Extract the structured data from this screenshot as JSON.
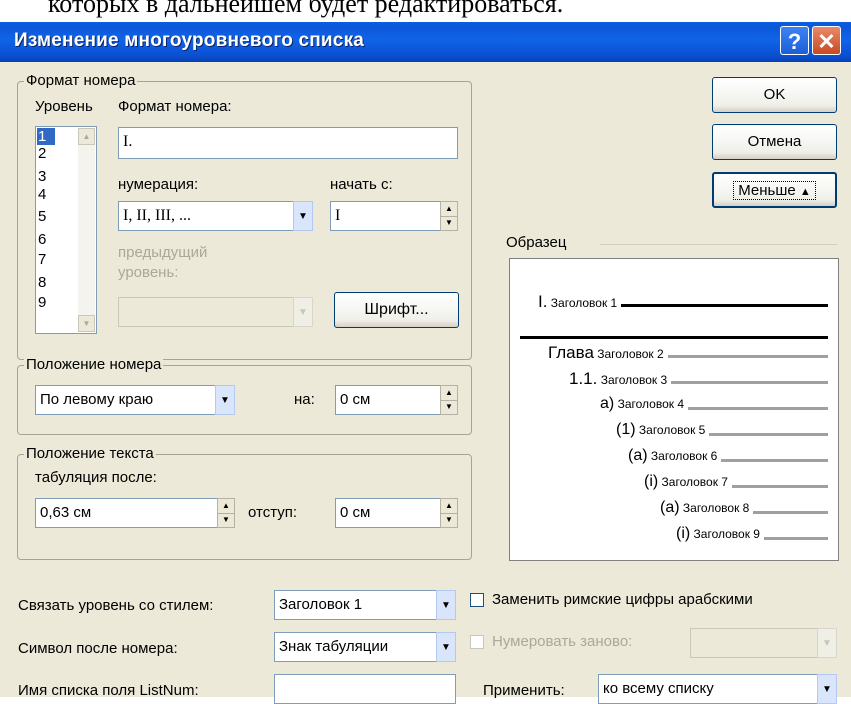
{
  "background_text": "которых в дальнейшем будет редактироваться.",
  "window": {
    "title": "Изменение многоуровневого списка",
    "help": "?",
    "close": "✕"
  },
  "number_format_group": {
    "legend": "Формат номера",
    "level_label": "Уровень",
    "format_label": "Формат номера:",
    "format_value": "I.",
    "levels": [
      "1",
      "2",
      "3",
      "4",
      "5",
      "6",
      "7",
      "8",
      "9"
    ],
    "selected_level": "1",
    "numbering_label": "нумерация:",
    "numbering_value": "I, II, III, ...",
    "start_label": "начать с:",
    "start_value": "I",
    "prev_level_label_1": "предыдущий",
    "prev_level_label_2": "уровень:",
    "font_button": "Шрифт..."
  },
  "buttons": {
    "ok": "OK",
    "cancel": "Отмена",
    "less": "Меньше"
  },
  "number_position_group": {
    "legend": "Положение номера",
    "align_value": "По левому краю",
    "at_label": "на:",
    "at_value": "0 см"
  },
  "text_position_group": {
    "legend": "Положение текста",
    "tab_label": "табуляция после:",
    "tab_value": "0,63 см",
    "indent_label": "отступ:",
    "indent_value": "0 см"
  },
  "preview": {
    "legend": "Образец",
    "items": [
      {
        "num": "I.",
        "text": "Заголовок 1"
      },
      {
        "num": "Глава",
        "text": "Заголовок 2"
      },
      {
        "num": "1.1.",
        "text": "Заголовок 3"
      },
      {
        "num": "а)",
        "text": "Заголовок 4"
      },
      {
        "num": "(1)",
        "text": "Заголовок 5"
      },
      {
        "num": "(а)",
        "text": "Заголовок 6"
      },
      {
        "num": "(i)",
        "text": "Заголовок 7"
      },
      {
        "num": "(а)",
        "text": "Заголовок 8"
      },
      {
        "num": "(i)",
        "text": "Заголовок 9"
      }
    ]
  },
  "bottom": {
    "link_label": "Связать уровень со стилем:",
    "link_value": "Заголовок 1",
    "after_label": "Символ после номера:",
    "after_value": "Знак табуляции",
    "listnum_label": "Имя списка поля ListNum:",
    "listnum_value": "",
    "roman_label": "Заменить римские цифры арабскими",
    "restart_label": "Нумеровать заново:",
    "apply_label": "Применить:",
    "apply_value": "ко всему списку"
  },
  "colors": {
    "title_bar": "#0b58d8",
    "dialog_bg": "#ece9d8",
    "selection": "#316ac5",
    "close": "#c84a24"
  },
  "icons": [
    "help-icon",
    "close-icon",
    "dropdown-arrow-icon",
    "spin-up-icon",
    "spin-down-icon",
    "double-arrow-up-icon"
  ]
}
